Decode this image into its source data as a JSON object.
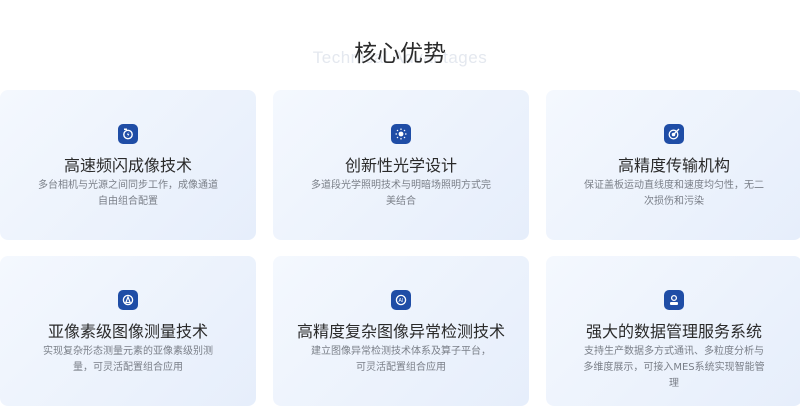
{
  "section": {
    "title": "核心优势",
    "subtitle": "Technical Advantages"
  },
  "cards": [
    {
      "icon": "lightning-camera-icon",
      "title": "高速频闪成像技术",
      "desc": "多台相机与光源之间同步工作，成像通道自由组合配置"
    },
    {
      "icon": "light-bulb-icon",
      "title": "创新性光学设计",
      "desc": "多道段光学照明技术与明暗场照明方式完美结合"
    },
    {
      "icon": "target-icon",
      "title": "高精度传输机构",
      "desc": "保证盖板运动直线度和速度均匀性，无二次损伤和污染"
    },
    {
      "icon": "measure-icon",
      "title": "亚像素级图像测量技术",
      "desc": "实现复杂形态测量元素的亚像素级别测量，可灵活配置组合应用"
    },
    {
      "icon": "ai-detect-icon",
      "title": "高精度复杂图像异常检测技术",
      "desc": "建立图像异常检测技术体系及算子平台，可灵活配置组合应用"
    },
    {
      "icon": "data-management-icon",
      "title": "强大的数据管理服务系统",
      "desc": "支持生产数据多方式通讯、多粒度分析与多维度展示，可接入MES系统实现智能管理"
    }
  ],
  "colors": {
    "icon_bg": "#1f4da6",
    "card_from": "#f4f8fe",
    "card_to": "#e6eefb"
  }
}
